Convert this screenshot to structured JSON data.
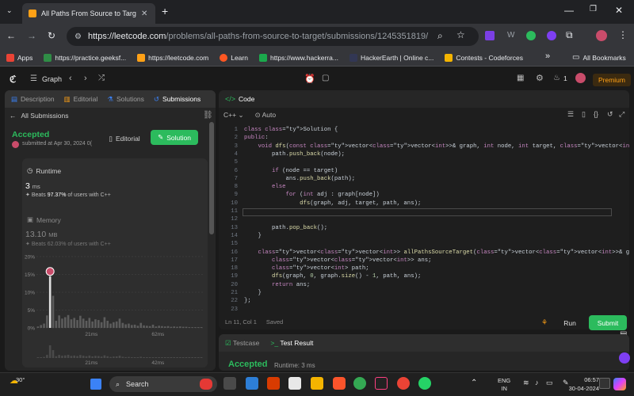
{
  "browser": {
    "tab_title": "All Paths From Source to Target - L",
    "url_domain": "https://leetcode.com",
    "url_path": "/problems/all-paths-from-source-to-target/submissions/1245351819/",
    "bookmarks": [
      {
        "label": "Apps",
        "color": "#ea4335"
      },
      {
        "label": "https://practice.geeksf...",
        "color": "#2f8d46"
      },
      {
        "label": "https://leetcode.com",
        "color": "#ffa116"
      },
      {
        "label": "Learn",
        "color": "#ff5722"
      },
      {
        "label": "https://www.hackerra...",
        "color": "#1ba94c"
      },
      {
        "label": "HackerEarth | Online c...",
        "color": "#323754"
      },
      {
        "label": "Contests - Codeforces",
        "color": "#f4b400"
      }
    ],
    "all_bookmarks": "All Bookmarks",
    "more": "»"
  },
  "nav": {
    "problem_list": "Graph",
    "premium": "Premium",
    "streak": "1"
  },
  "left": {
    "tabs": [
      "Description",
      "Editorial",
      "Solutions",
      "Submissions"
    ],
    "back": "All Submissions",
    "status": "Accepted",
    "submitted": "submitted at Apr 30, 2024 0(",
    "editorial_btn": "Editorial",
    "solution_btn": "Solution",
    "runtime_label": "Runtime",
    "runtime_value": "3",
    "runtime_unit": "ms",
    "runtime_beats_prefix": "Beats",
    "runtime_beats": "97.37%",
    "runtime_beats_suffix": "of users with C++",
    "memory_label": "Memory",
    "memory_value": "13.10",
    "memory_unit": "MB",
    "memory_beats_prefix": "Beats",
    "memory_beats": "62.03%",
    "memory_beats_suffix": "of users with C++"
  },
  "chart_data": {
    "type": "bar",
    "ylabel_ticks": [
      "20%",
      "15%",
      "10%",
      "5%",
      "0%"
    ],
    "y_values": [
      20,
      15,
      10,
      5,
      0
    ],
    "x_tick_labels": [
      "21ms",
      "62ms"
    ],
    "mini_x_tick_labels": [
      "21ms",
      "42ms"
    ],
    "values": [
      0.4,
      0.8,
      1.2,
      3.5,
      14.5,
      9.0,
      2.0,
      3.5,
      2.6,
      3.0,
      3.6,
      2.4,
      2.8,
      2.2,
      3.4,
      2.6,
      2.0,
      2.8,
      1.8,
      2.4,
      2.2,
      1.6,
      3.0,
      2.0,
      1.2,
      1.6,
      1.8,
      2.6,
      1.4,
      1.0,
      1.2,
      0.8,
      0.9,
      0.6,
      1.4,
      0.7,
      0.6,
      0.5,
      0.9,
      0.4,
      0.6,
      0.5,
      0.4,
      0.5,
      0.3,
      0.4,
      0.3,
      0.4,
      0.3,
      0.3,
      0.2,
      0.2,
      0.2,
      0.2,
      0.2
    ],
    "highlight_index": 4,
    "ylim": [
      0,
      20
    ],
    "bar_color": "#5c5c5c",
    "highlight_color": "#e0e0e0"
  },
  "editor": {
    "title": "Code",
    "language": "C++",
    "auto": "Auto",
    "status_pos": "Ln 11, Col 1",
    "status_saved": "Saved",
    "run": "Run",
    "submit": "Submit",
    "lines": [
      "class Solution {",
      "public:",
      "    void dfs(const vector<vector<int>>& graph, int node, int target, vector<int>& path, vector<vector<int>>& ans) {",
      "        path.push_back(node);",
      "",
      "        if (node == target)",
      "            ans.push_back(path);",
      "        else",
      "            for (int adj : graph[node])",
      "                dfs(graph, adj, target, path, ans);",
      "",
      "",
      "        path.pop_back();",
      "    }",
      "",
      "    vector<vector<int>> allPathsSourceTarget(vector<vector<int>>& graph) {",
      "        vector<vector<int>> ans;",
      "        vector<int> path;",
      "        dfs(graph, 0, graph.size() - 1, path, ans);",
      "        return ans;",
      "    }",
      "};",
      ""
    ]
  },
  "bottom": {
    "testcase": "Testcase",
    "test_result": "Test Result",
    "accepted": "Accepted",
    "runtime": "Runtime: 3 ms"
  },
  "taskbar": {
    "weather": "30°",
    "search": "Search",
    "lang": "ENG",
    "region": "IN",
    "time": "06:57",
    "date": "30-04-2024"
  }
}
